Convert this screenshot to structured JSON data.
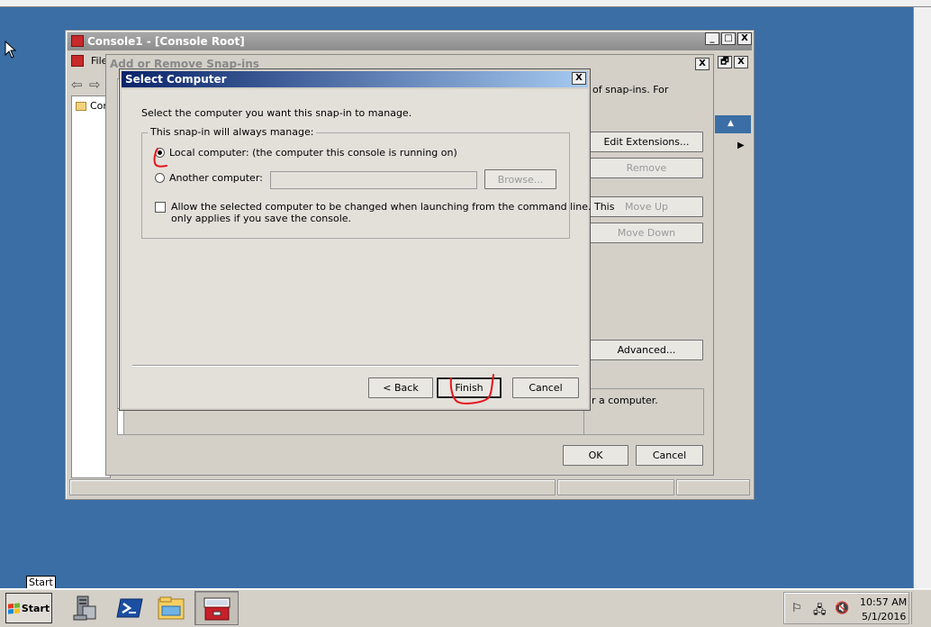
{
  "mmc_window": {
    "title": "Console1 - [Console Root]",
    "menu_file": "File",
    "tree_item": "Console Root",
    "win_min": "_",
    "win_max": "□",
    "win_close": "X",
    "inner_restore": "🗗",
    "inner_close": "X"
  },
  "snapins_dialog": {
    "title": "Add or Remove Snap-ins",
    "close": "X",
    "desc_partial": "of snap-ins. For",
    "buttons": {
      "edit_extensions": "Edit Extensions...",
      "remove": "Remove",
      "move_up": "Move Up",
      "move_down": "Move Down",
      "advanced": "Advanced...",
      "ok": "OK",
      "cancel": "Cancel"
    },
    "description_partial": "r a computer."
  },
  "select_dialog": {
    "title": "Select Computer",
    "close": "X",
    "prompt": "Select the computer you want this snap-in to manage.",
    "group_label": "This snap-in will always manage:",
    "local_computer": "Local computer:  (the computer this console is running on)",
    "local_selected": true,
    "another_computer": "Another computer:",
    "another_value": "",
    "browse": "Browse...",
    "allow_change_line1": "Allow the selected computer to be changed when launching from the command line.  This",
    "allow_change_line2": "only applies if you save the console.",
    "allow_change_checked": false,
    "back": "< Back",
    "finish": "Finish",
    "cancel": "Cancel"
  },
  "tooltip": "Start",
  "taskbar": {
    "start_label": "Start",
    "clock_time": "10:57 AM",
    "clock_date": "5/1/2016",
    "icons": [
      "server-manager-icon",
      "powershell-icon",
      "explorer-icon",
      "mmc-toolbox-icon"
    ]
  },
  "colors": {
    "desktop": "#3a6ea5",
    "dialog_title_start": "#0a246a",
    "annotation": "#e8141c"
  }
}
